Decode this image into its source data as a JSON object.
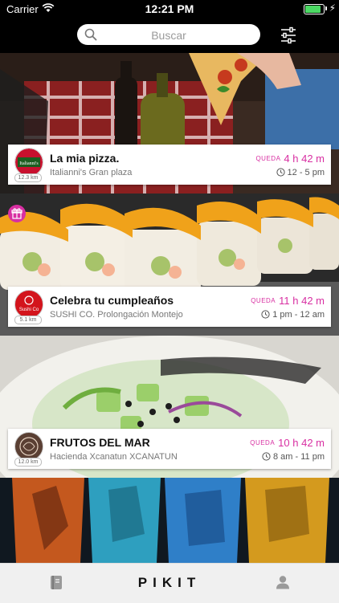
{
  "status_bar": {
    "carrier": "Carrier",
    "time": "12:21 PM",
    "battery_level": 0.95
  },
  "header": {
    "search_placeholder": "Buscar",
    "icons": [
      "search-icon",
      "filter-icon"
    ]
  },
  "cards": [
    {
      "title": "La mia pizza.",
      "subtitle": "Italianni's Gran plaza",
      "logo_text": "Italianni's",
      "distance": "12.3 km",
      "remaining_label": "QUEDA",
      "remaining": "4 h 42 m",
      "hours": "12 - 5 pm",
      "gift": false
    },
    {
      "title": "Celebra tu cumpleaños",
      "subtitle": "SUSHI CO. Prolongación Montejo",
      "logo_text": "Sushi Co",
      "distance": "5.1 km",
      "remaining_label": "QUEDA",
      "remaining": "11 h 42 m",
      "hours": "1 pm - 12 am",
      "gift": true
    },
    {
      "title": "FRUTOS DEL MAR",
      "subtitle": "Hacienda Xcanatun XCANATUN",
      "logo_text": "",
      "distance": "12.0 km",
      "remaining_label": "QUEDA",
      "remaining": "10 h 42 m",
      "hours": "8 am - 11 pm",
      "gift": false
    }
  ],
  "tabbar": {
    "brand": "PIKIT",
    "icons": [
      "notebook-icon",
      "profile-icon"
    ]
  },
  "colors": {
    "accent": "#d82fa2",
    "header_bg": "#000000",
    "tabbar_bg": "#f0f0f0"
  }
}
